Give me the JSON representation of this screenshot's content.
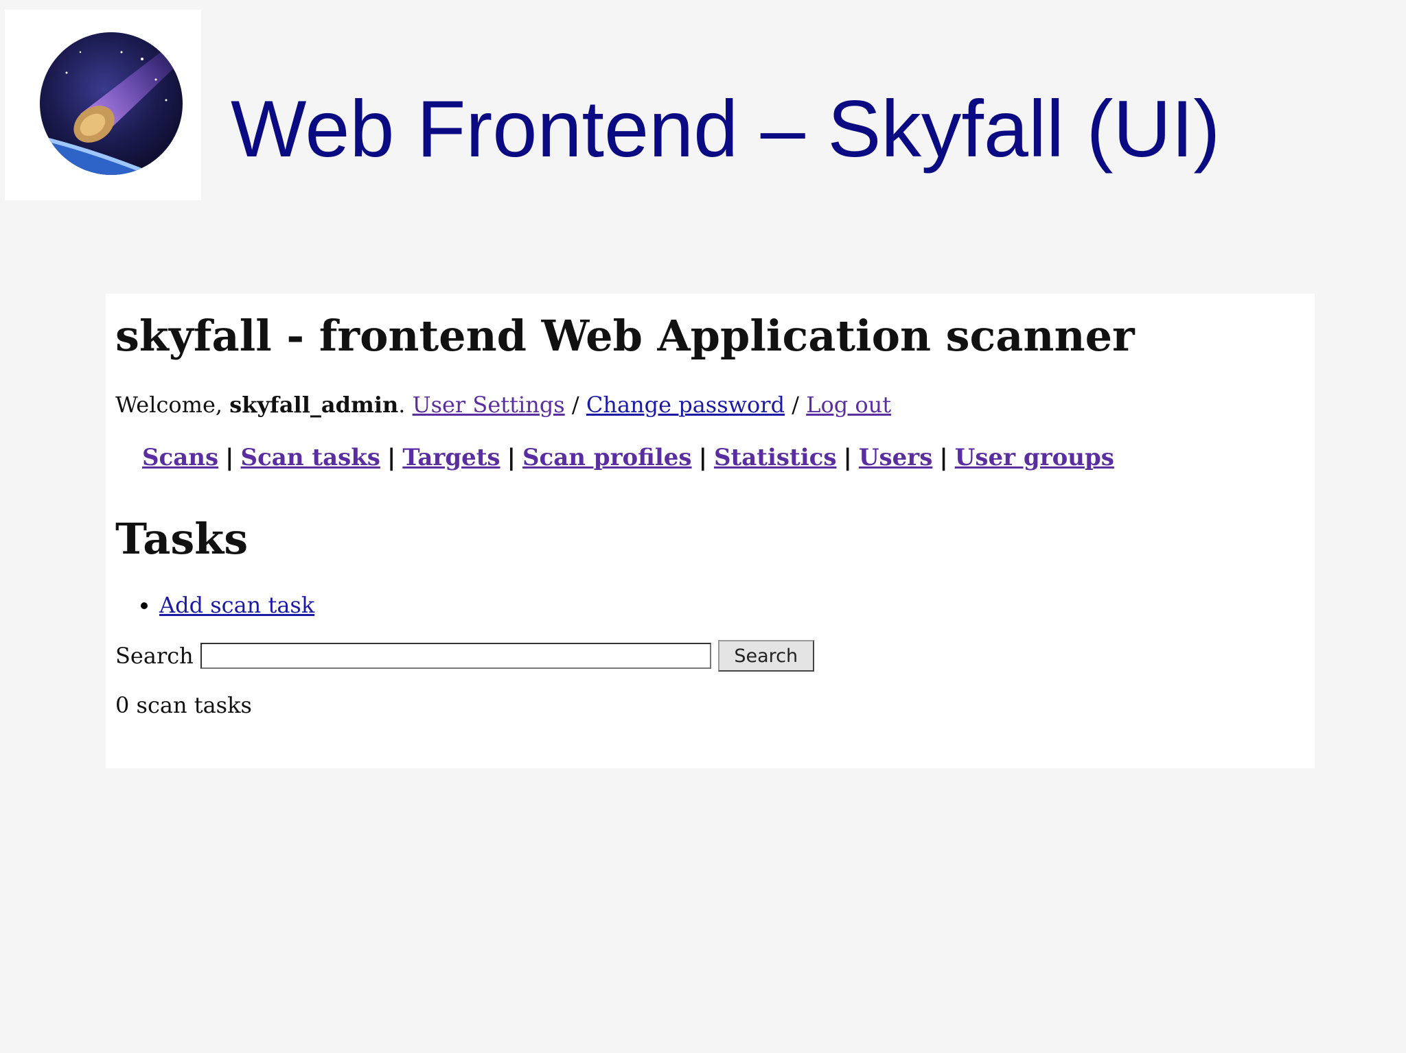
{
  "slide": {
    "title": "Web Frontend – Skyfall (UI)"
  },
  "app": {
    "title": "skyfall - frontend Web Application scanner",
    "welcome_prefix": "Welcome, ",
    "username": "skyfall_admin",
    "welcome_period": ".",
    "user_settings": "User Settings",
    "separator": " / ",
    "change_password": "Change password",
    "log_out": "Log out"
  },
  "nav": {
    "items": [
      "Scans",
      "Scan tasks",
      "Targets",
      "Scan profiles",
      "Statistics",
      "Users",
      "User groups"
    ],
    "separator": "|"
  },
  "tasks": {
    "heading": "Tasks",
    "add_link": "Add scan task",
    "search_label": "Search",
    "search_value": "",
    "search_button": "Search",
    "count_text": "0 scan tasks"
  },
  "colors": {
    "slide_title": "#0a0a82",
    "link": "#1a1aa6",
    "visited_link": "#5a2ea0",
    "page_background": "#f5f5f6"
  },
  "icons": {
    "logo": "meteor-logo-icon"
  }
}
